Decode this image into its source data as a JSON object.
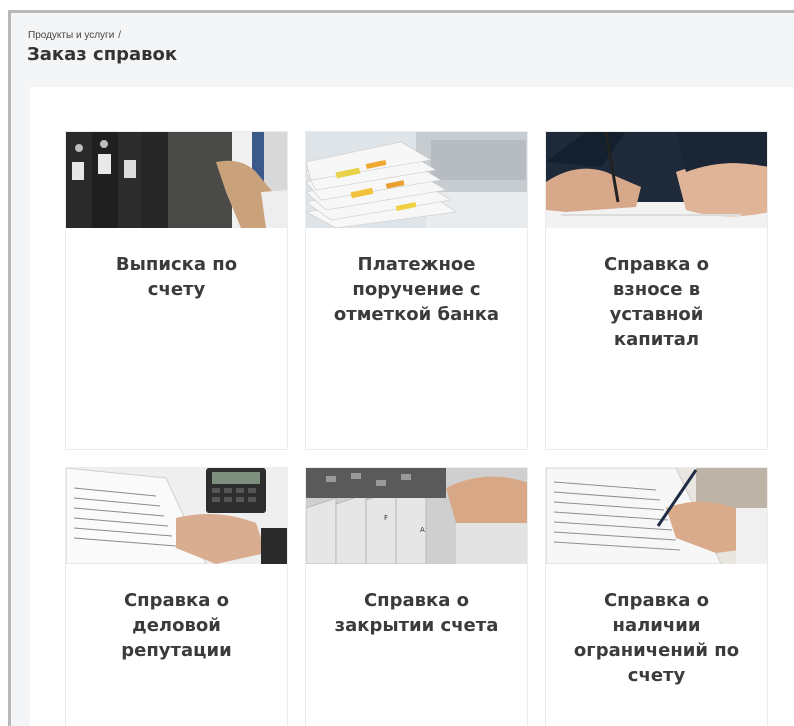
{
  "breadcrumb": {
    "parent": "Продукты и услуги",
    "separator": "/"
  },
  "page": {
    "title": "Заказ справок"
  },
  "cards": [
    {
      "title": [
        "Выписка по",
        "счету"
      ],
      "image": "binders-photo"
    },
    {
      "title": [
        "Платежное",
        "поручение с",
        "отметкой банка"
      ],
      "image": "documents-stack-photo"
    },
    {
      "title": [
        "Справка о",
        "взносе в",
        "уставной",
        "капитал"
      ],
      "image": "signing-document-photo"
    },
    {
      "title": [
        "Справка о",
        "деловой",
        "репутации"
      ],
      "image": "paper-calculator-photo"
    },
    {
      "title": [
        "Справка о",
        "закрытии счета"
      ],
      "image": "file-cabinet-photo"
    },
    {
      "title": [
        "Справка о",
        "наличии",
        "ограничений по",
        "счету"
      ],
      "image": "pen-paper-photo"
    }
  ]
}
